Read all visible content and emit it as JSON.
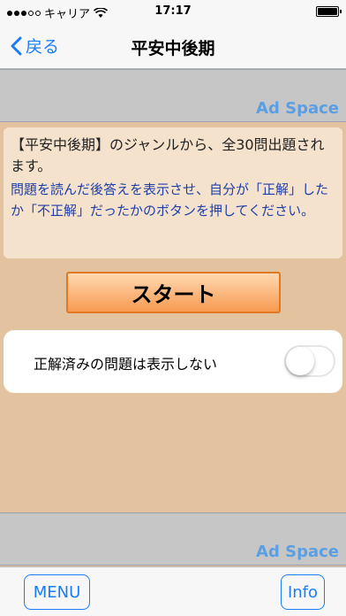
{
  "status_bar": {
    "carrier": "キャリア",
    "time": "17:17",
    "battery_level": 1.0
  },
  "nav": {
    "back_label": "戻る",
    "title": "平安中後期"
  },
  "ads": {
    "top_label": "Ad Space",
    "bottom_label": "Ad Space"
  },
  "info": {
    "main_text": "【平安中後期】のジャンルから、全30問出題されます。",
    "sub_text": "問題を読んだ後答えを表示させ、自分が「正解」したか「不正解」だったかのボタンを押してください。"
  },
  "start_button": {
    "label": "スタート"
  },
  "setting": {
    "label": "正解済みの問題は表示しない",
    "enabled": false
  },
  "toolbar": {
    "menu_label": "MENU",
    "info_label": "Info"
  },
  "colors": {
    "accent": "#1a7cf6",
    "background": "#e3c2a0",
    "button_border": "#e07a22",
    "ad_label": "#5a9fe4",
    "info_sub_text": "#1f3ea8"
  }
}
